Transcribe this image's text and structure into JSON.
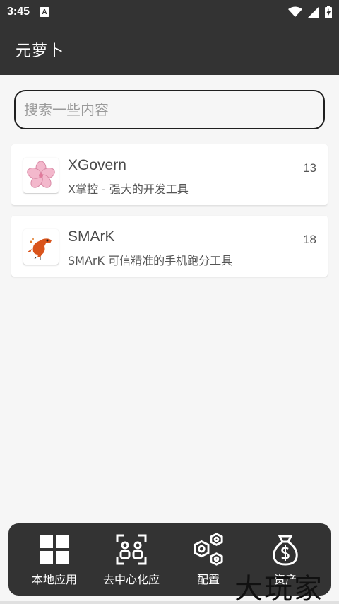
{
  "status_bar": {
    "time": "3:45",
    "notification_icon": "A"
  },
  "app_bar": {
    "title": "元萝卜"
  },
  "search": {
    "placeholder": "搜索一些内容",
    "value": ""
  },
  "apps": [
    {
      "name": "XGovern",
      "description": "X掌控 - 强大的开发工具",
      "count": "13",
      "icon": "sakura-flower-icon",
      "icon_color": "#f3b8cc"
    },
    {
      "name": "SMArK",
      "description": "SMArK 可信精准的手机跑分工具",
      "count": "18",
      "icon": "dinosaur-icon",
      "icon_color": "#d9541c"
    }
  ],
  "bottom_nav": {
    "items": [
      {
        "label": "本地应用",
        "icon": "grid-icon"
      },
      {
        "label": "去中心化应",
        "icon": "people-scan-icon"
      },
      {
        "label": "配置",
        "icon": "hex-nuts-icon"
      },
      {
        "label": "资产",
        "icon": "money-bag-icon"
      }
    ]
  },
  "watermark": "大玩家",
  "colors": {
    "bar_background": "#333333",
    "page_background": "#f6f6f6",
    "card_background": "#ffffff"
  }
}
